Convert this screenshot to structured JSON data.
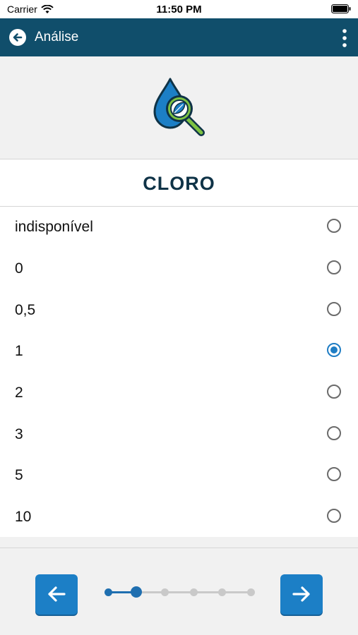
{
  "status_bar": {
    "carrier": "Carrier",
    "time": "11:50 PM"
  },
  "app_bar": {
    "title": "Análise"
  },
  "section": {
    "title": "CLORO"
  },
  "options": [
    {
      "label": "indisponível",
      "selected": false
    },
    {
      "label": "0",
      "selected": false
    },
    {
      "label": "0,5",
      "selected": false
    },
    {
      "label": "1",
      "selected": true
    },
    {
      "label": "2",
      "selected": false
    },
    {
      "label": "3",
      "selected": false
    },
    {
      "label": "5",
      "selected": false
    },
    {
      "label": "10",
      "selected": false
    }
  ],
  "stepper": {
    "total_steps": 6,
    "current_step": 2
  },
  "colors": {
    "header": "#104e6b",
    "accent": "#1c7fc6",
    "title": "#0f3347",
    "drop": "#1c7fc6",
    "magnifier": "#7dc242"
  },
  "icons": {
    "back": "arrow-left-circle-icon",
    "menu": "more-vertical-icon",
    "hero": "water-drop-magnifier-icon",
    "prev": "arrow-left-icon",
    "next": "arrow-right-icon"
  }
}
